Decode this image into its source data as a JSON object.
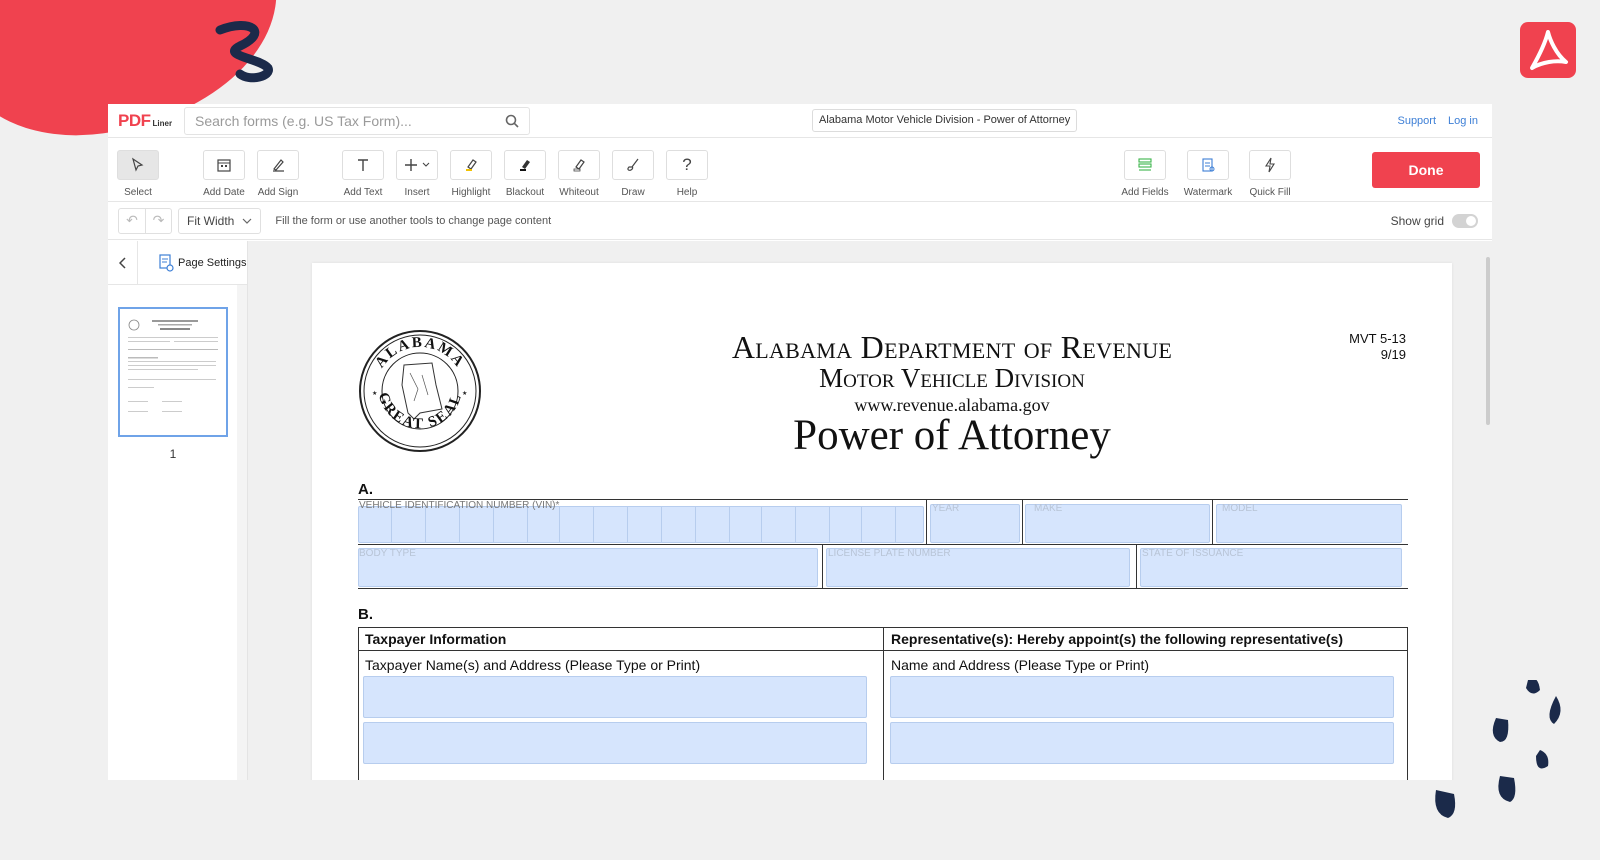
{
  "brand": {
    "pdf": "PDF",
    "liner": "Liner"
  },
  "search": {
    "placeholder": "Search forms (e.g. US Tax Form)..."
  },
  "doc_title": "Alabama Motor Vehicle Division - Power of Attorney",
  "top_links": {
    "support": "Support",
    "login": "Log in"
  },
  "toolbar": {
    "tools": {
      "select": "Select",
      "add_date": "Add Date",
      "add_sign": "Add Sign",
      "add_text": "Add Text",
      "insert": "Insert",
      "highlight": "Highlight",
      "blackout": "Blackout",
      "whiteout": "Whiteout",
      "draw": "Draw",
      "help": "Help",
      "add_fields": "Add Fields",
      "watermark": "Watermark",
      "quick_fill": "Quick Fill"
    },
    "done": "Done"
  },
  "subbar": {
    "zoom": "Fit Width",
    "hint": "Fill the form or use another tools to change page content",
    "show_grid": "Show grid"
  },
  "sidebar": {
    "page_settings": "Page Settings",
    "page_number": "1"
  },
  "document": {
    "form_code": "MVT 5-13",
    "form_date": "9/19",
    "heading1": "Alabama Department of Revenue",
    "heading2": "Motor Vehicle Division",
    "website": "www.revenue.alabama.gov",
    "title": "Power of Attorney",
    "seal": {
      "top": "ALABAMA",
      "bottom": "GREAT SEAL"
    },
    "section_a": {
      "letter": "A.",
      "vin": "VEHICLE IDENTIFICATION NUMBER (VIN)*",
      "year": "YEAR",
      "make": "MAKE",
      "model": "MODEL",
      "body_type": "BODY TYPE",
      "plate": "LICENSE PLATE NUMBER",
      "state": "STATE OF ISSUANCE"
    },
    "section_b": {
      "letter": "B.",
      "taxpayer_header": "Taxpayer Information",
      "rep_header": "Representative(s): Hereby appoint(s) the following representative(s)",
      "taxpayer_sub": "Taxpayer Name(s) and Address (Please Type or Print)",
      "rep_sub": "Name and Address (Please Type or Print)"
    }
  },
  "colors": {
    "accent": "#f0424f",
    "link": "#3d7fd6",
    "field": "#d6e5fd",
    "navy": "#1b2a4a"
  }
}
